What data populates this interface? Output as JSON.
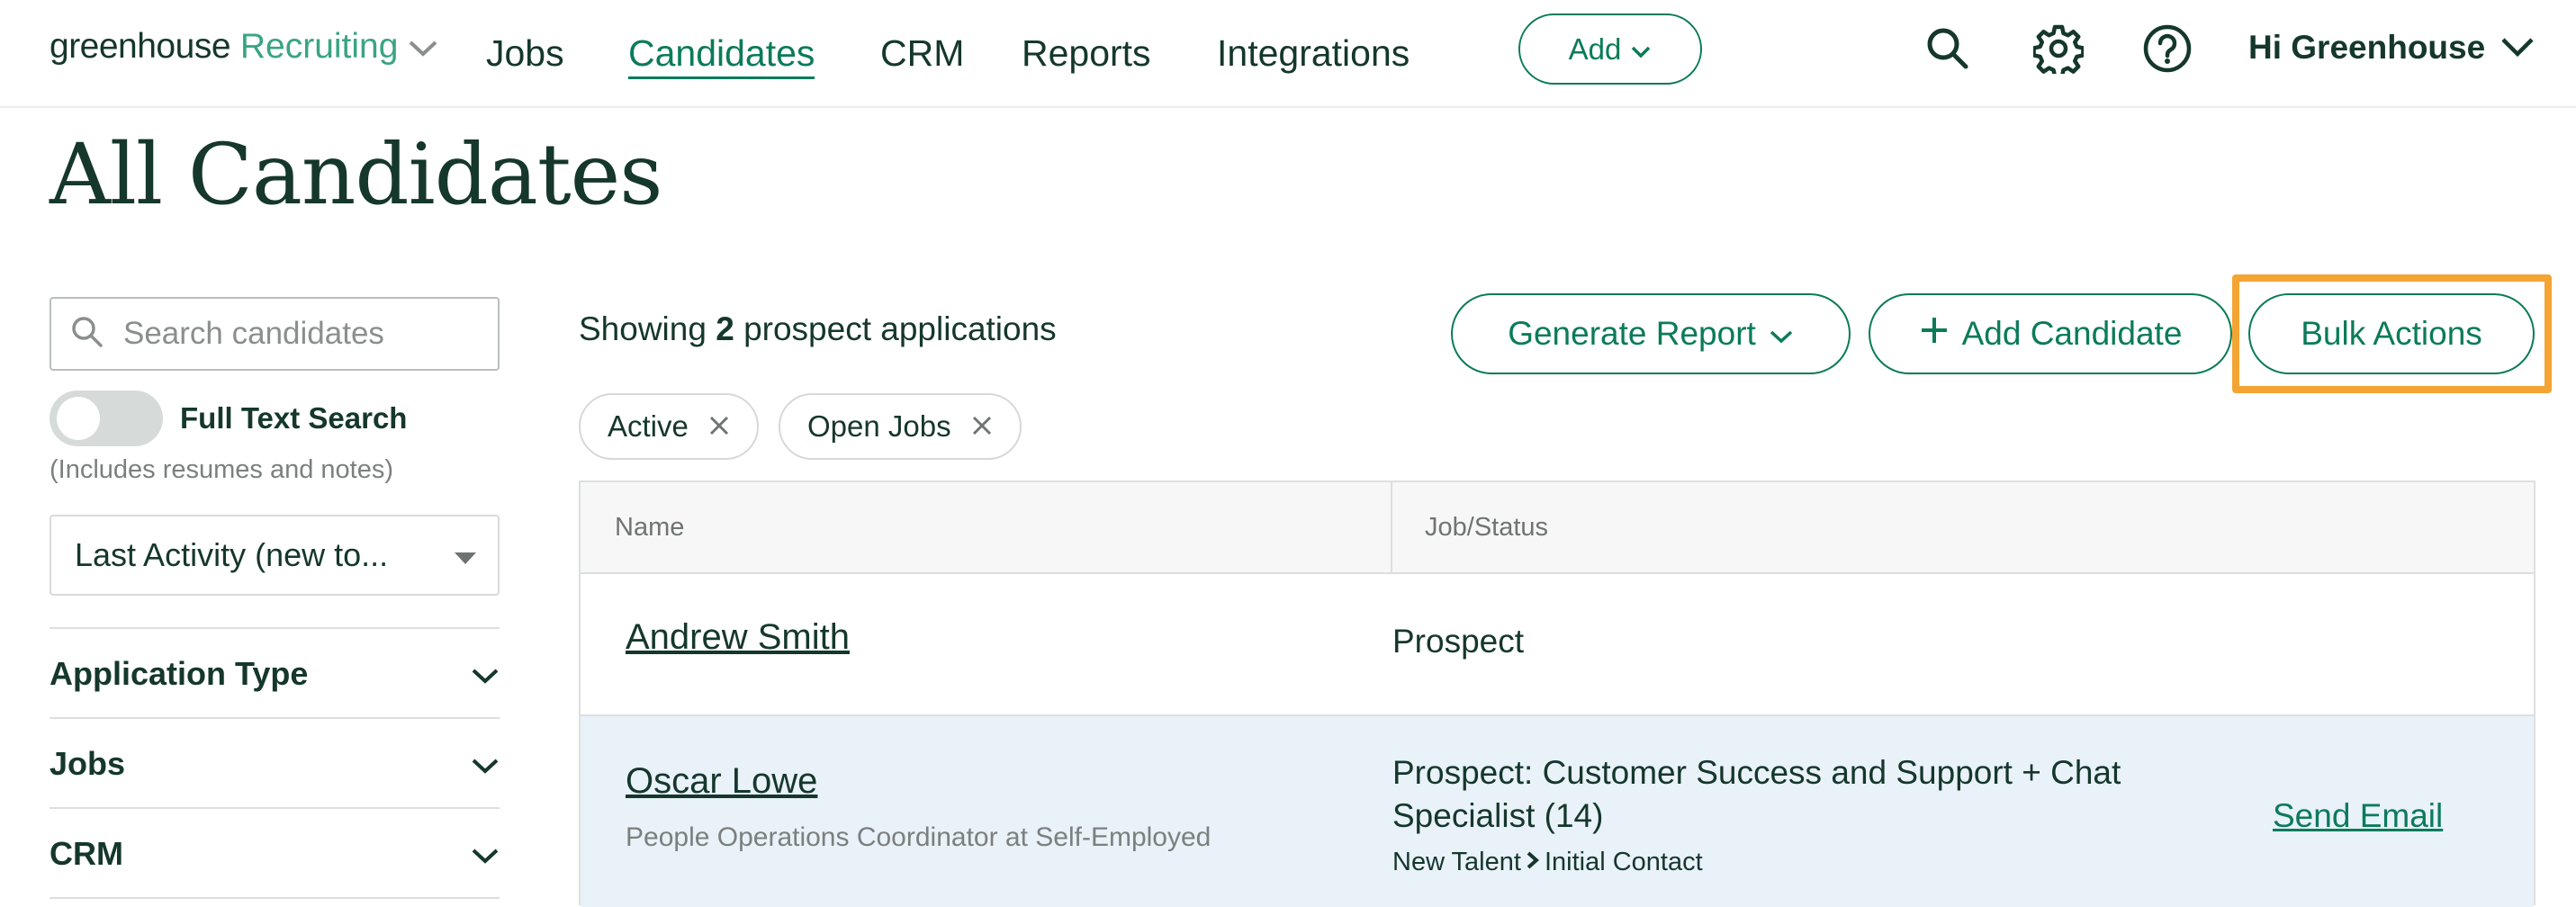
{
  "brand": {
    "name": "greenhouse",
    "product": "Recruiting"
  },
  "nav": {
    "items": [
      "Jobs",
      "Candidates",
      "CRM",
      "Reports",
      "Integrations"
    ],
    "active": "Candidates",
    "add_label": "Add",
    "user_greeting": "Hi Greenhouse"
  },
  "page": {
    "title": "All Candidates"
  },
  "sidebar": {
    "search_placeholder": "Search candidates",
    "full_text_label": "Full Text Search",
    "full_text_note": "(Includes resumes and notes)",
    "full_text_enabled": false,
    "sort_value": "Last Activity (new to...",
    "facets": [
      "Application Type",
      "Jobs",
      "CRM"
    ]
  },
  "results": {
    "showing_prefix": "Showing",
    "count": "2",
    "showing_suffix": "prospect applications"
  },
  "actions": {
    "generate_report": "Generate Report",
    "add_candidate": "Add Candidate",
    "bulk_actions": "Bulk Actions"
  },
  "filters": [
    "Active",
    "Open Jobs"
  ],
  "table": {
    "headers": {
      "name": "Name",
      "job_status": "Job/Status"
    },
    "rows": [
      {
        "name": "Andrew Smith",
        "subtitle": "",
        "status": "Prospect",
        "stage_from": "",
        "stage_to": "",
        "action": ""
      },
      {
        "name": "Oscar Lowe",
        "subtitle": "People Operations Coordinator at Self-Employed",
        "status_line1": "Prospect: Customer Success and Support + Chat",
        "status_line2": "Specialist (14)",
        "stage_from": "New Talent",
        "stage_to": "Initial Contact",
        "action": "Send Email"
      }
    ]
  },
  "colors": {
    "brand_green": "#0b7b5a",
    "highlight": "#f4a433",
    "selected_row": "#e9f1f9"
  }
}
